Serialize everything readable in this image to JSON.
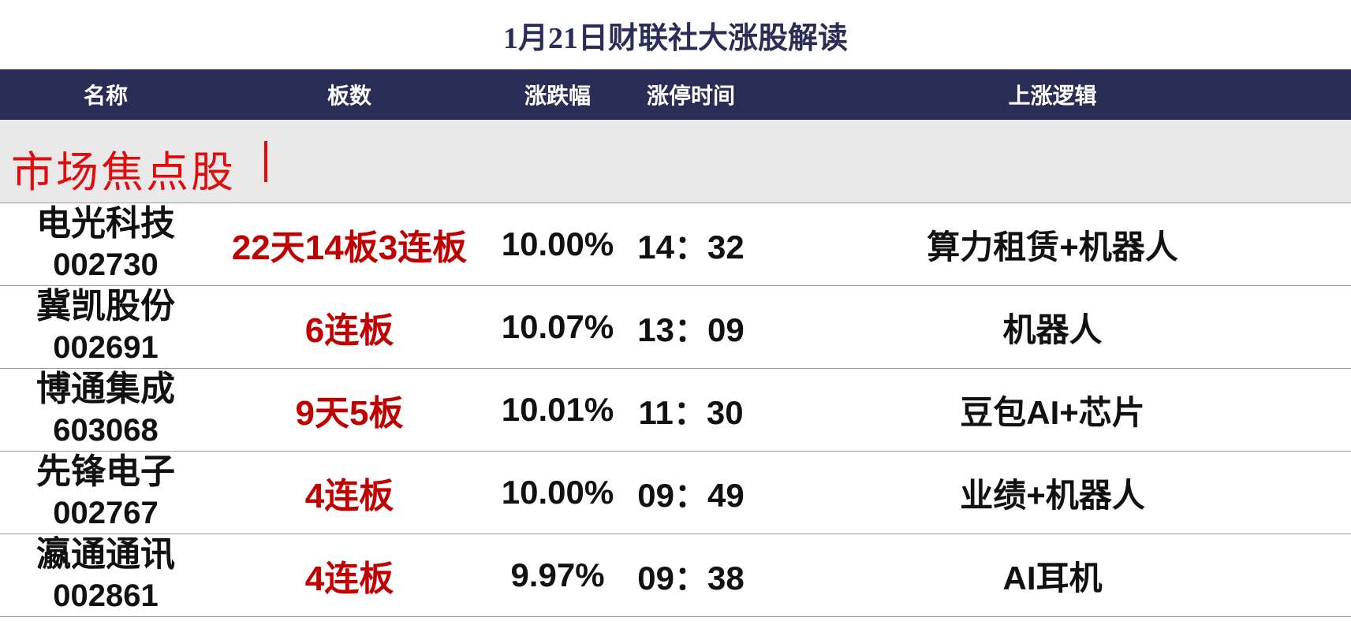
{
  "title": "1月21日财联社大涨股解读",
  "headers": {
    "name": "名称",
    "boards": "板数",
    "change": "涨跌幅",
    "limit_time": "涨停时间",
    "logic": "上涨逻辑"
  },
  "section": {
    "label": "市场焦点股"
  },
  "rows": [
    {
      "name": "电光科技",
      "code": "002730",
      "boards": "22天14板3连板",
      "change": "10.00%",
      "time": "14：32",
      "logic": "算力租赁+机器人"
    },
    {
      "name": "冀凯股份",
      "code": "002691",
      "boards": "6连板",
      "change": "10.07%",
      "time": "13：09",
      "logic": "机器人"
    },
    {
      "name": "博通集成",
      "code": "603068",
      "boards": "9天5板",
      "change": "10.01%",
      "time": "11：30",
      "logic": "豆包AI+芯片"
    },
    {
      "name": "先锋电子",
      "code": "002767",
      "boards": "4连板",
      "change": "10.00%",
      "time": "09：49",
      "logic": "业绩+机器人"
    },
    {
      "name": "瀛通通讯",
      "code": "002861",
      "boards": "4连板",
      "change": "9.97%",
      "time": "09：38",
      "logic": "AI耳机"
    }
  ],
  "colors": {
    "header_bg": "#2a2d55",
    "section_bg": "#e9e9e9",
    "accent_red": "#e00d0d",
    "board_red": "#c00000"
  }
}
